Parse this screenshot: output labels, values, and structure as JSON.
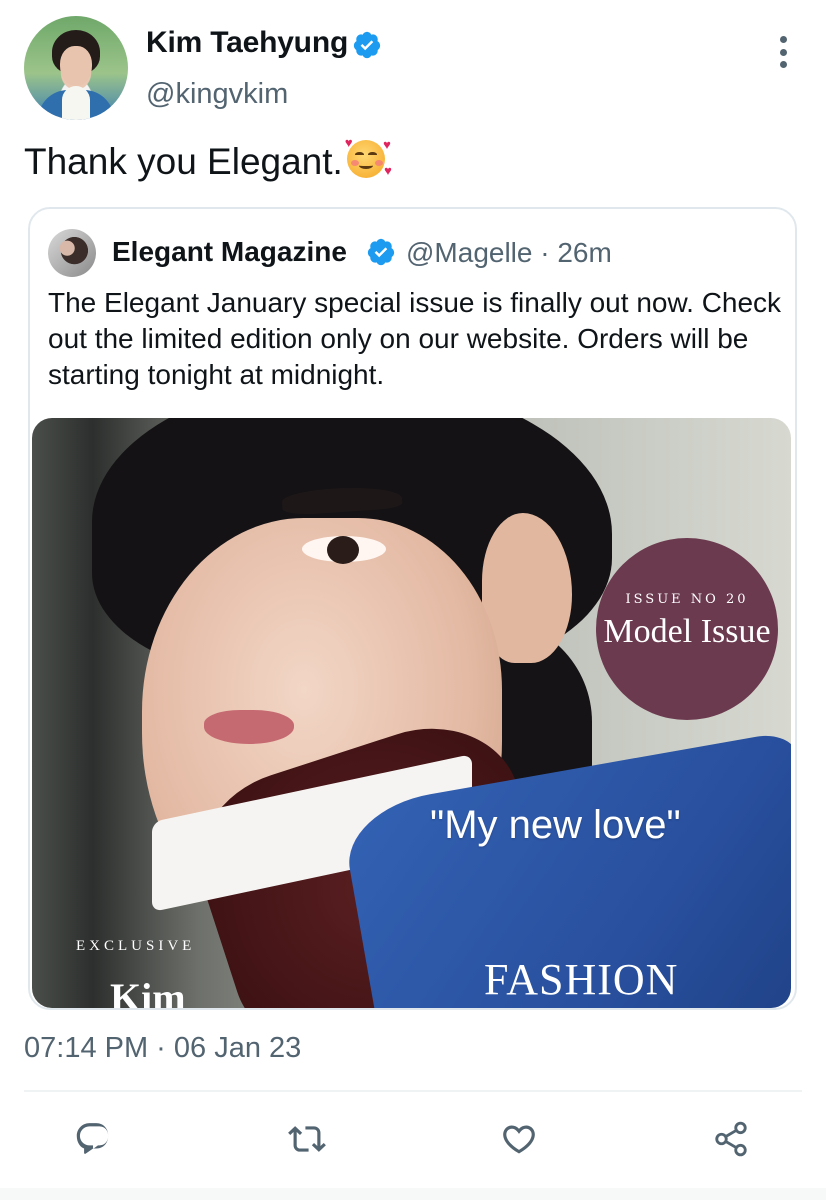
{
  "tweet": {
    "author_name": "Kim Taehyung",
    "author_handle": "@kingvkim",
    "text": "Thank you Elegant.",
    "text_emoji": "smiling-face-with-hearts-icon",
    "timestamp": "07:14 PM · 06 Jan 23"
  },
  "quote": {
    "author_name": "Elegant Magazine",
    "handle_time": "@Magelle · 26m",
    "text": "The Elegant January special issue is finally out now. Check out the limited edition only on our website. Orders will be starting tonight at midnight.",
    "cover": {
      "issue_number": "ISSUE NO 20",
      "issue_title": "Model Issue",
      "quote": "\"My new love\"",
      "exclusive": "EXCLUSIVE",
      "name": "Kim",
      "section": "FASHION"
    }
  },
  "actions": {
    "reply_icon": "reply-icon",
    "retweet_icon": "retweet-icon",
    "like_icon": "heart-icon",
    "share_icon": "share-icon"
  },
  "colors": {
    "verified": "#1d9bf0",
    "secondary_text": "#536471",
    "badge": "#6b3a4f",
    "border": "#e1e8ed"
  }
}
